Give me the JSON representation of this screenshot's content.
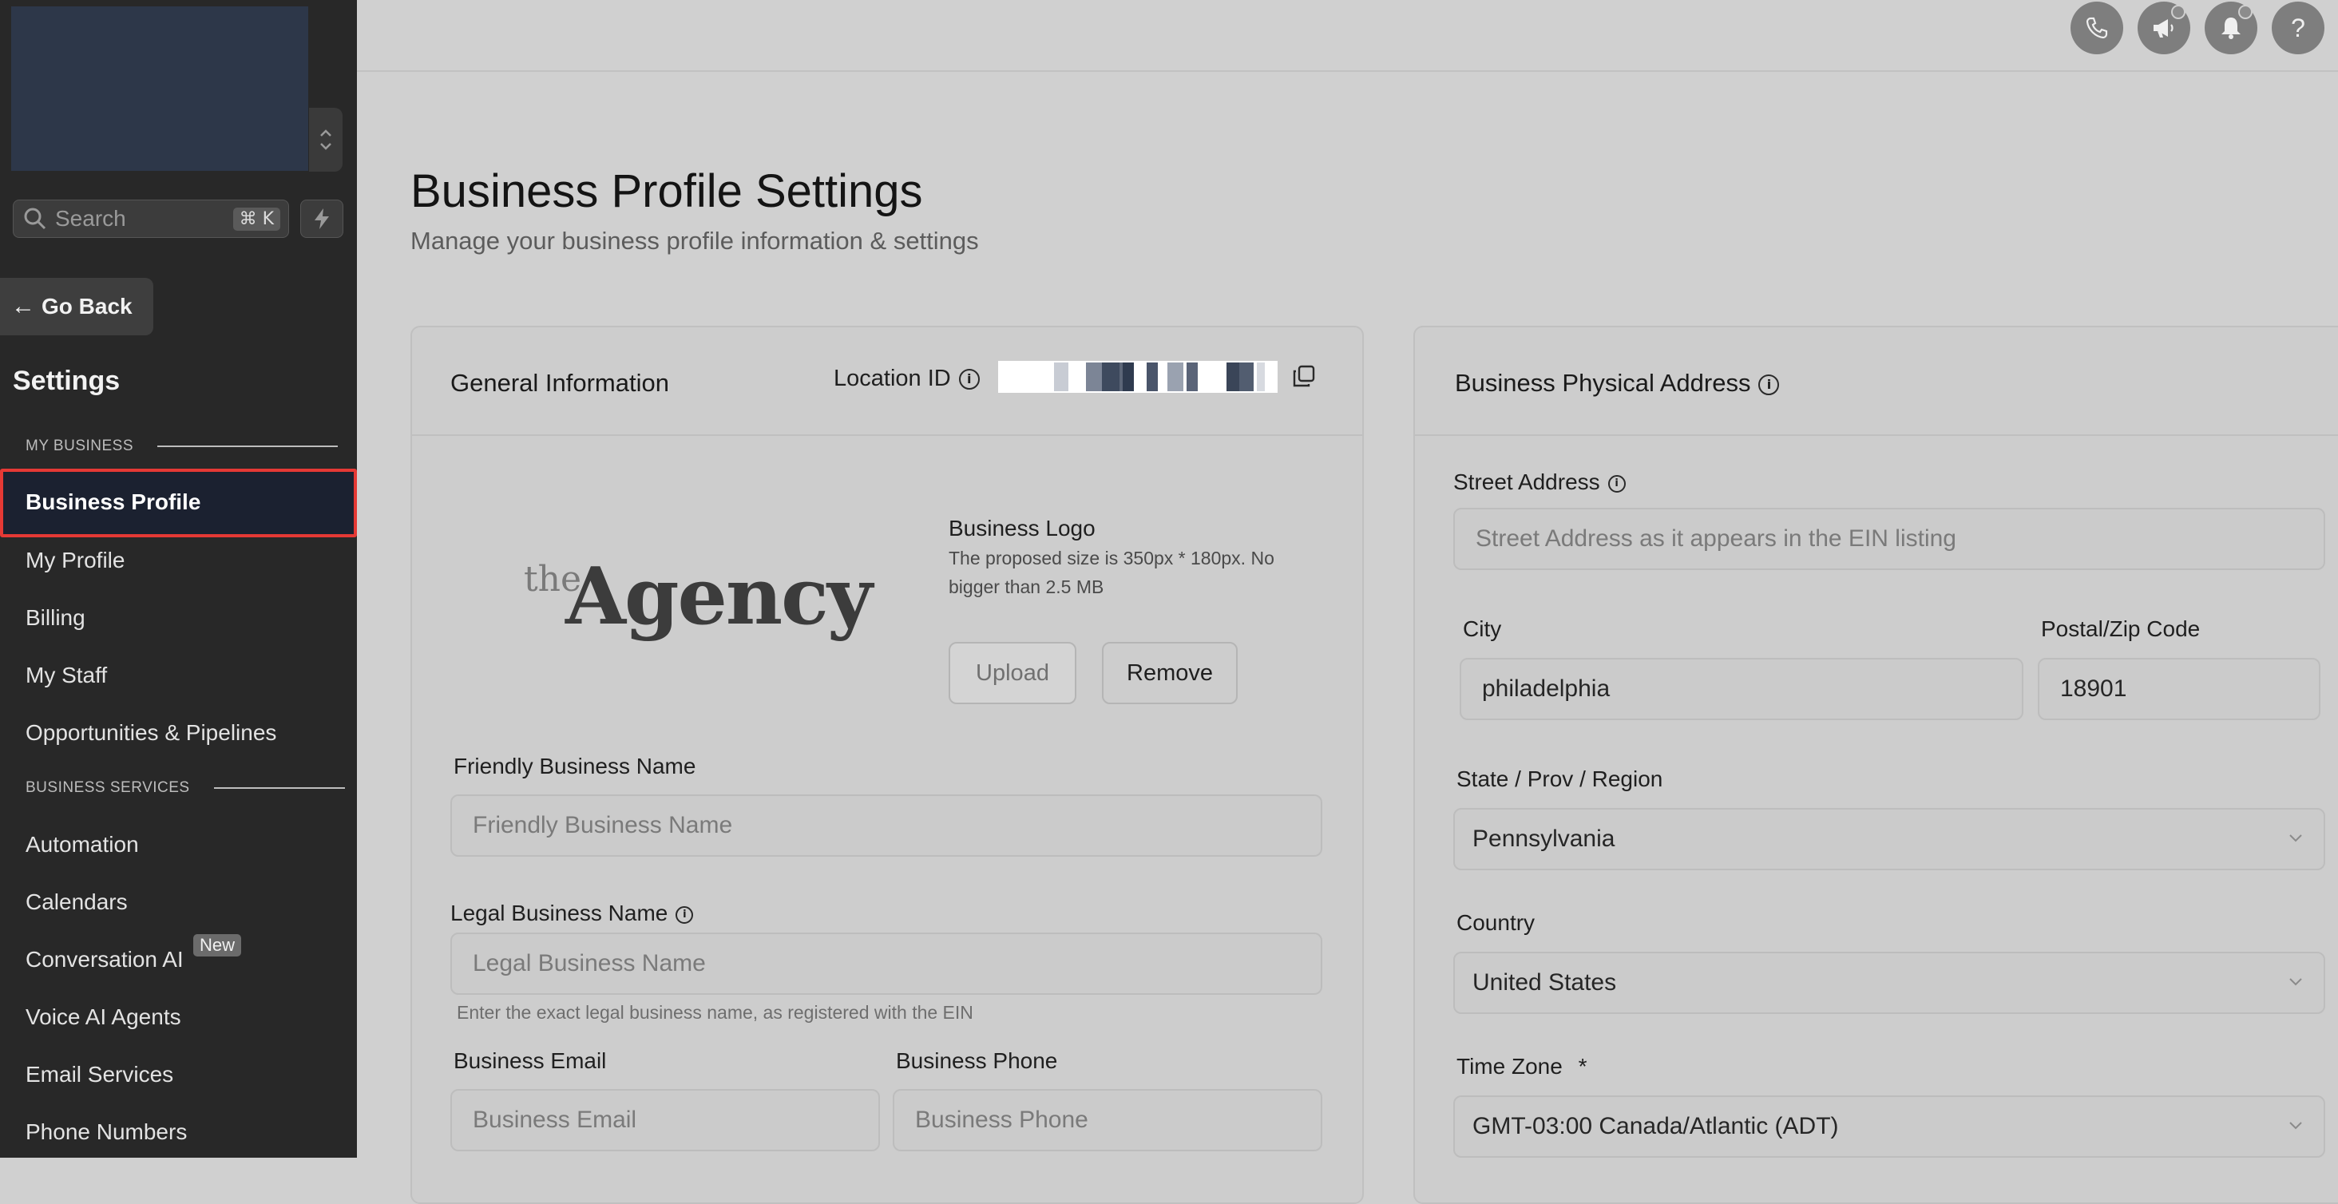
{
  "sidebar": {
    "search": {
      "placeholder": "Search",
      "shortcut": "⌘ K"
    },
    "go_back": "Go Back",
    "title": "Settings",
    "sections": [
      {
        "label": "MY BUSINESS"
      },
      {
        "label": "BUSINESS SERVICES"
      }
    ],
    "items": [
      {
        "label": "Business Profile"
      },
      {
        "label": "My Profile"
      },
      {
        "label": "Billing"
      },
      {
        "label": "My Staff"
      },
      {
        "label": "Opportunities & Pipelines"
      },
      {
        "label": "Automation"
      },
      {
        "label": "Calendars"
      },
      {
        "label": "Conversation AI"
      },
      {
        "label": "Voice AI Agents"
      },
      {
        "label": "Email Services"
      },
      {
        "label": "Phone Numbers"
      }
    ],
    "new_badge": "New"
  },
  "header": {
    "icons": [
      "phone-icon",
      "megaphone-icon",
      "bell-icon",
      "help-icon"
    ],
    "help_glyph": "?"
  },
  "page": {
    "title": "Business Profile Settings",
    "subtitle": "Manage your business profile information & settings"
  },
  "general": {
    "title": "General Information",
    "location_id_label": "Location ID",
    "logo": {
      "wordmark_small": "the",
      "wordmark_large": "Agency",
      "label": "Business Logo",
      "hint_line1": "The proposed size is 350px * 180px. No",
      "hint_line2": "bigger than 2.5 MB",
      "upload": "Upload",
      "remove": "Remove"
    },
    "friendly_name": {
      "label": "Friendly Business Name",
      "placeholder": "Friendly Business Name"
    },
    "legal_name": {
      "label": "Legal Business Name",
      "placeholder": "Legal Business Name",
      "hint": "Enter the exact legal business name, as registered with the EIN"
    },
    "email": {
      "label": "Business Email",
      "placeholder": "Business Email"
    },
    "phone": {
      "label": "Business Phone",
      "placeholder": "Business Phone"
    }
  },
  "address": {
    "title": "Business Physical Address",
    "street": {
      "label": "Street Address",
      "placeholder": "Street Address as it appears in the EIN listing"
    },
    "city": {
      "label": "City",
      "value": "philadelphia"
    },
    "zip": {
      "label": "Postal/Zip Code",
      "value": "18901"
    },
    "state": {
      "label": "State / Prov / Region",
      "value": "Pennsylvania"
    },
    "country": {
      "label": "Country",
      "value": "United States"
    },
    "timezone": {
      "label": "Time Zone",
      "required": "*",
      "value": "GMT-03:00 Canada/Atlantic (ADT)"
    }
  }
}
